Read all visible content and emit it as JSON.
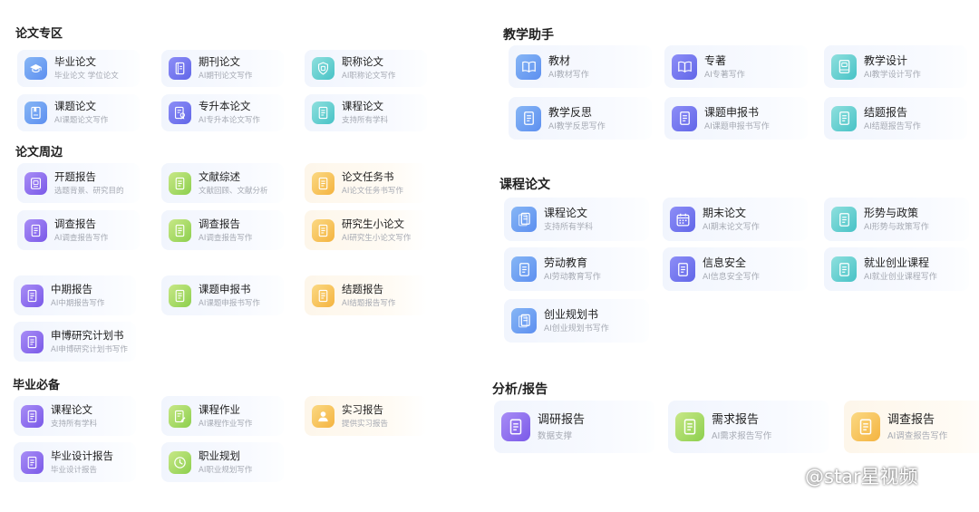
{
  "left": {
    "sections": [
      {
        "title": "论文专区",
        "items": [
          {
            "name": "毕业论文",
            "desc": "毕业论文 学位论文",
            "icon": "graduation-cap-icon",
            "color": "blue"
          },
          {
            "name": "期刊论文",
            "desc": "AI期刊论文写作",
            "icon": "journal-icon",
            "color": "indigo"
          },
          {
            "name": "职称论文",
            "desc": "AI职称论文写作",
            "icon": "shield-icon",
            "color": "teal"
          },
          {
            "name": "课题论文",
            "desc": "AI课题论文写作",
            "icon": "bookmark-doc-icon",
            "color": "blue"
          },
          {
            "name": "专升本论文",
            "desc": "AI专升本论文写作",
            "icon": "badge-doc-icon",
            "color": "indigo"
          },
          {
            "name": "课程论文",
            "desc": "支持所有学科",
            "icon": "document-icon",
            "color": "teal"
          }
        ]
      },
      {
        "title": "论文周边",
        "items": [
          {
            "name": "开题报告",
            "desc": "选题背景、研究目的",
            "icon": "report-icon",
            "color": "purple"
          },
          {
            "name": "文献综述",
            "desc": "文献回顾、文献分析",
            "icon": "document-icon",
            "color": "green"
          },
          {
            "name": "论文任务书",
            "desc": "AI论文任务书写作",
            "icon": "document-icon",
            "color": "orange"
          },
          {
            "name": "调查报告",
            "desc": "AI调查报告写作",
            "icon": "document-icon",
            "color": "purple"
          },
          {
            "name": "调查报告",
            "desc": "AI调查报告写作",
            "icon": "document-icon",
            "color": "green"
          },
          {
            "name": "研究生小论文",
            "desc": "AI研究生小论文写作",
            "icon": "document-icon",
            "color": "orange"
          },
          {
            "name": "中期报告",
            "desc": "AI中期报告写作",
            "icon": "document-icon",
            "color": "purple"
          },
          {
            "name": "课题申报书",
            "desc": "AI课题申报书写作",
            "icon": "document-icon",
            "color": "green"
          },
          {
            "name": "结题报告",
            "desc": "AI结题报告写作",
            "icon": "document-icon",
            "color": "orange"
          },
          {
            "name": "申博研究计划书",
            "desc": "AI申博研究计划书写作",
            "icon": "document-icon",
            "color": "purple"
          }
        ]
      },
      {
        "title": "毕业必备",
        "items": [
          {
            "name": "课程论文",
            "desc": "支持所有学科",
            "icon": "document-icon",
            "color": "purple"
          },
          {
            "name": "课程作业",
            "desc": "AI课程作业写作",
            "icon": "edit-doc-icon",
            "color": "green"
          },
          {
            "name": "实习报告",
            "desc": "提供实习报告",
            "icon": "user-icon",
            "color": "orange"
          },
          {
            "name": "毕业设计报告",
            "desc": "毕业设计报告",
            "icon": "document-icon",
            "color": "purple"
          },
          {
            "name": "职业规划",
            "desc": "AI职业规划写作",
            "icon": "clock-icon",
            "color": "green"
          }
        ]
      }
    ]
  },
  "right": {
    "sections": [
      {
        "title": "教学助手",
        "items": [
          {
            "name": "教材",
            "desc": "AI教材写作",
            "icon": "book-open-icon",
            "color": "blue"
          },
          {
            "name": "专著",
            "desc": "AI专著写作",
            "icon": "book-open-icon",
            "color": "indigo"
          },
          {
            "name": "教学设计",
            "desc": "AI教学设计写作",
            "icon": "book-icon",
            "color": "teal"
          },
          {
            "name": "教学反思",
            "desc": "AI教学反思写作",
            "icon": "document-icon",
            "color": "blue"
          },
          {
            "name": "课题申报书",
            "desc": "AI课题申报书写作",
            "icon": "document-icon",
            "color": "indigo"
          },
          {
            "name": "结题报告",
            "desc": "AI结题报告写作",
            "icon": "document-icon",
            "color": "teal"
          }
        ]
      },
      {
        "title": "课程论文",
        "items": [
          {
            "name": "课程论文",
            "desc": "支持所有学科",
            "icon": "documents-icon",
            "color": "blue"
          },
          {
            "name": "期末论文",
            "desc": "AI期末论文写作",
            "icon": "calendar-icon",
            "color": "indigo"
          },
          {
            "name": "形势与政策",
            "desc": "AI形势与政策写作",
            "icon": "document-icon",
            "color": "teal"
          },
          {
            "name": "劳动教育",
            "desc": "AI劳动教育写作",
            "icon": "document-icon",
            "color": "blue"
          },
          {
            "name": "信息安全",
            "desc": "AI信息安全写作",
            "icon": "document-icon",
            "color": "indigo"
          },
          {
            "name": "就业创业课程",
            "desc": "AI就业创业课程写作",
            "icon": "document-icon",
            "color": "teal"
          },
          {
            "name": "创业规划书",
            "desc": "AI创业规划书写作",
            "icon": "documents-icon",
            "color": "blue"
          }
        ]
      },
      {
        "title": "分析/报告",
        "items": [
          {
            "name": "调研报告",
            "desc": "数据支撑",
            "icon": "document-icon",
            "color": "purple"
          },
          {
            "name": "需求报告",
            "desc": "AI需求报告写作",
            "icon": "document-icon",
            "color": "green"
          },
          {
            "name": "调查报告",
            "desc": "AI调查报告写作",
            "icon": "document-icon",
            "color": "orange"
          }
        ]
      }
    ]
  },
  "watermark": {
    "text": "@star星视频",
    "icon": "weibo-icon"
  }
}
